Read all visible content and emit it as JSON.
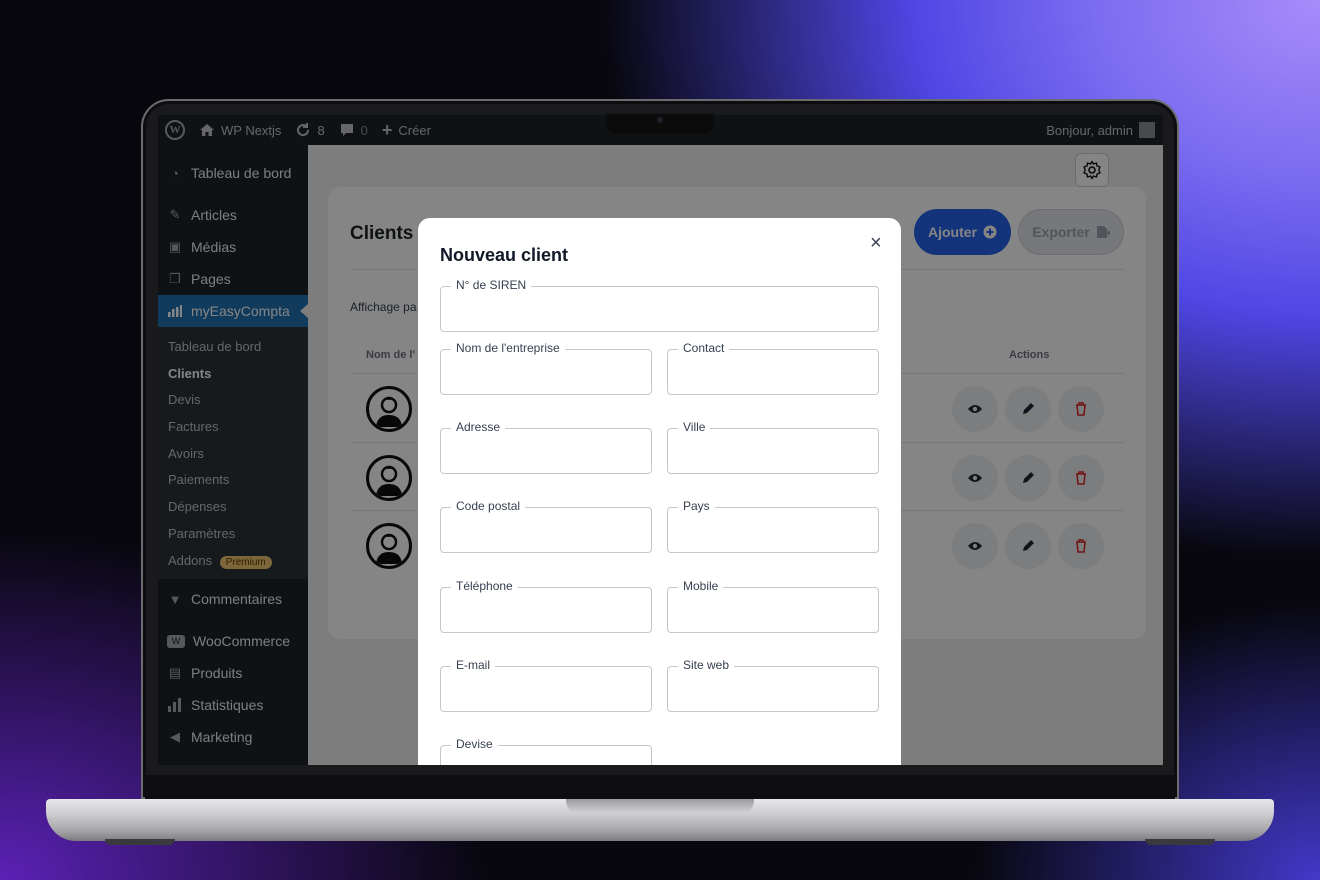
{
  "adminbar": {
    "site_name": "WP Nextjs",
    "updates_count": "8",
    "comments_count": "0",
    "new_label": "Créer",
    "greeting": "Bonjour, admin"
  },
  "sidebar": {
    "items": [
      {
        "label": "Tableau de bord",
        "icon": "dashboard-icon"
      },
      {
        "label": "Articles",
        "icon": "pin-icon"
      },
      {
        "label": "Médias",
        "icon": "media-icon"
      },
      {
        "label": "Pages",
        "icon": "pages-icon"
      },
      {
        "label": "myEasyCompta",
        "icon": "chart-icon"
      }
    ],
    "submenu": [
      "Tableau de bord",
      "Clients",
      "Devis",
      "Factures",
      "Avoirs",
      "Paiements",
      "Dépenses",
      "Paramètres",
      "Addons"
    ],
    "premium_badge": "Premium",
    "bottom_items": [
      {
        "label": "Commentaires",
        "icon": "comment-icon"
      },
      {
        "label": "WooCommerce",
        "icon": "woo-icon"
      },
      {
        "label": "Produits",
        "icon": "products-icon"
      },
      {
        "label": "Statistiques",
        "icon": "stats-icon"
      },
      {
        "label": "Marketing",
        "icon": "megaphone-icon"
      }
    ]
  },
  "page": {
    "title": "Clients",
    "add_label": "Ajouter",
    "export_label": "Exporter",
    "showing": "Affichage pa",
    "col_name": "Nom de l'",
    "col_actions": "Actions"
  },
  "modal": {
    "title": "Nouveau client",
    "close": "×",
    "fields": {
      "siren": "N° de SIREN",
      "company": "Nom de l'entreprise",
      "contact": "Contact",
      "address": "Adresse",
      "city": "Ville",
      "zip": "Code postal",
      "country": "Pays",
      "phone": "Téléphone",
      "mobile": "Mobile",
      "email": "E-mail",
      "website": "Site web",
      "currency": "Devise"
    }
  },
  "colors": {
    "wp_dark": "#1d2327",
    "wp_blue": "#2271b1",
    "primary": "#2563eb",
    "danger": "#dc2626"
  }
}
